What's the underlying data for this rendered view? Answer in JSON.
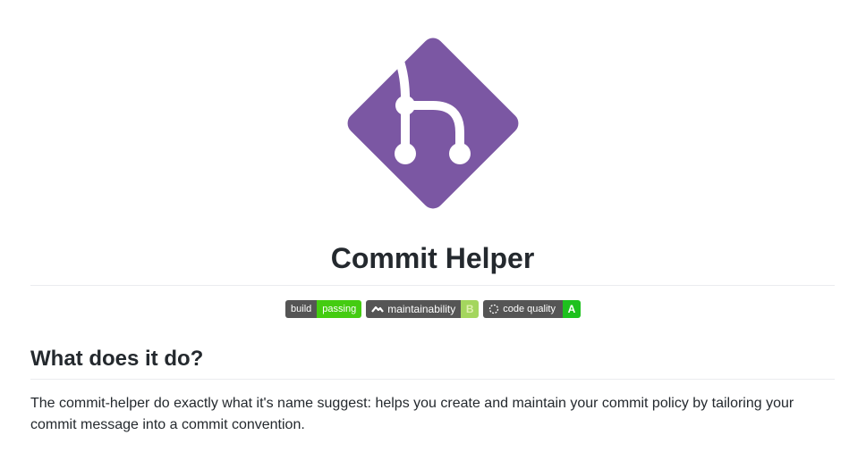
{
  "header": {
    "title": "Commit Helper",
    "logo_icon": "git-branch-diamond-icon",
    "logo_color": "#7b57a3"
  },
  "badges": [
    {
      "left": "build",
      "right": "passing",
      "right_color": "#4c1"
    },
    {
      "icon": "codeclimate-icon",
      "left": "maintainability",
      "right": "B",
      "right_color": "#a4d65e"
    },
    {
      "icon": "codacy-icon",
      "left": "code quality",
      "right": "A",
      "right_color": "#1ec11e"
    }
  ],
  "section": {
    "heading": "What does it do?",
    "body": "The commit-helper do exactly what it's name suggest: helps you create and maintain your commit policy by tailoring your commit message into a commit convention."
  }
}
